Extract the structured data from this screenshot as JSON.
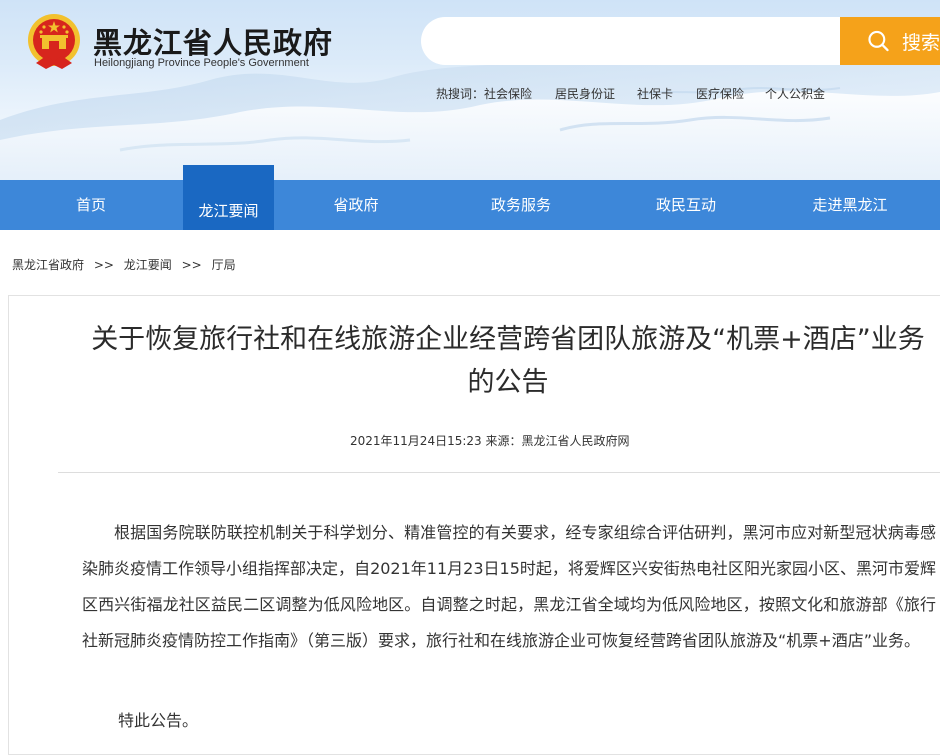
{
  "header": {
    "title": "黑龙江省人民政府",
    "subtitle": "Heilongjiang Province People's Government",
    "search": {
      "placeholder": "",
      "button_label": "搜索"
    },
    "hot_search": {
      "label": "热搜词：",
      "terms": [
        "社会保险",
        "居民身份证",
        "社保卡",
        "医疗保险",
        "个人公积金"
      ]
    }
  },
  "nav": {
    "items": [
      "首页",
      "龙江要闻",
      "省政府",
      "政务服务",
      "政民互动",
      "走进黑龙江"
    ],
    "active": "龙江要闻"
  },
  "breadcrumb": [
    "黑龙江省政府",
    "龙江要闻",
    "厅局"
  ],
  "breadcrumb_sep": ">>",
  "article": {
    "title": "关于恢复旅行社和在线旅游企业经营跨省团队旅游及“机票+酒店”业务的公告",
    "meta": "2021年11月24日15:23 来源：黑龙江省人民政府网",
    "body": "根据国务院联防联控机制关于科学划分、精准管控的有关要求，经专家组综合评估研判，黑河市应对新型冠状病毒感染肺炎疫情工作领导小组指挥部决定，自2021年11月23日15时起，将爱辉区兴安街热电社区阳光家园小区、黑河市爱辉区西兴街福龙社区益民二区调整为低风险地区。自调整之时起，黑龙江省全域均为低风险地区，按照文化和旅游部《旅行社新冠肺炎疫情防控工作指南》（第三版）要求，旅行社和在线旅游企业可恢复经营跨省团队旅游及“机票+酒店”业务。",
    "closing": "特此公告。"
  },
  "colors": {
    "nav": "#3d87d9",
    "nav_active": "#1a68c2",
    "search_button": "#f5a21a",
    "emblem_red": "#d7251d",
    "emblem_gold": "#f2c12e"
  },
  "icons": {
    "search": "search-icon",
    "emblem": "national-emblem-icon"
  }
}
